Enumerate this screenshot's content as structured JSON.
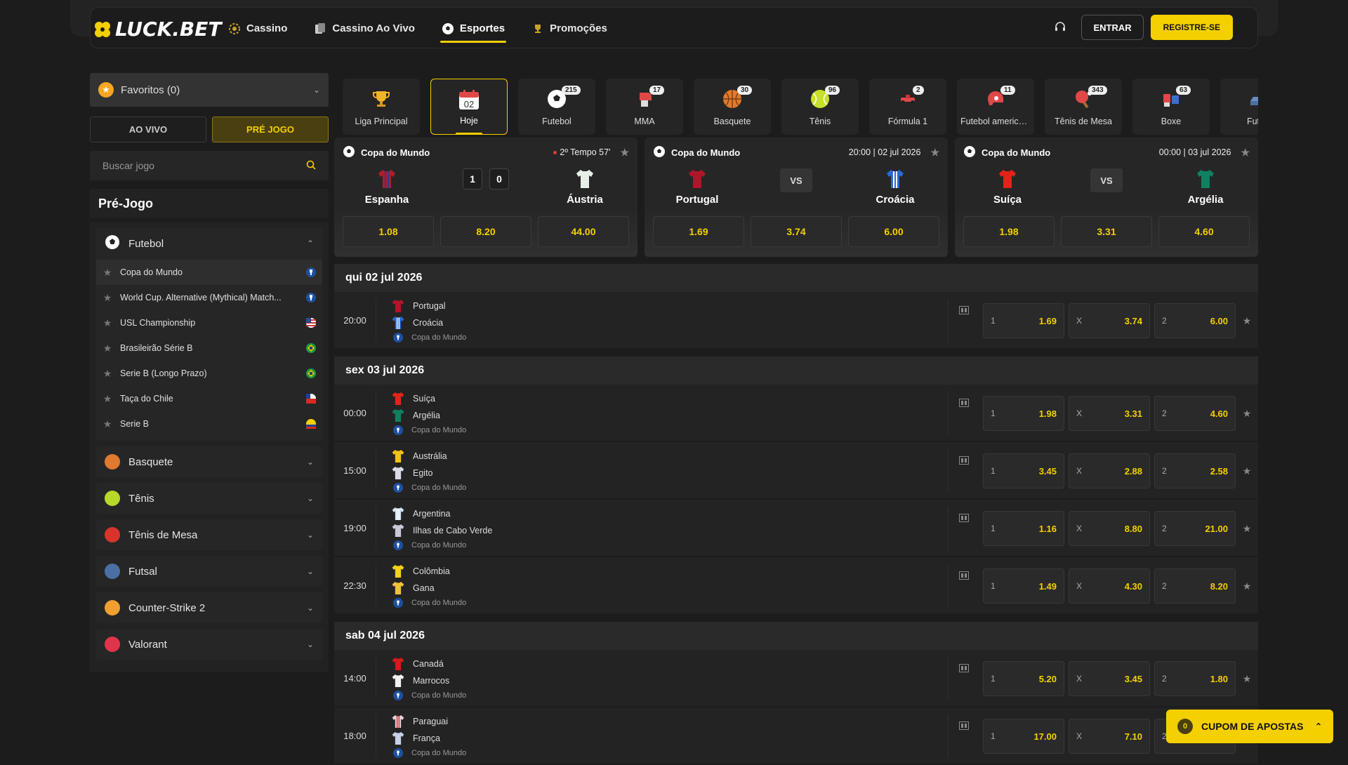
{
  "header": {
    "logo": "LUCK.BET",
    "nav": [
      {
        "label": "Cassino",
        "icon": "casino-chip-icon"
      },
      {
        "label": "Cassino Ao Vivo",
        "icon": "live-cards-icon"
      },
      {
        "label": "Esportes",
        "icon": "soccer-ball-icon"
      },
      {
        "label": "Promoções",
        "icon": "trophy-icon"
      }
    ],
    "login": "ENTRAR",
    "register": "REGISTRE-SE"
  },
  "sidebar": {
    "favorites": "Favoritos (0)",
    "tab_live": "AO VIVO",
    "tab_pre": "PRÉ JOGO",
    "search_placeholder": "Buscar jogo",
    "section_title": "Pré-Jogo",
    "football": "Futebol",
    "leagues": [
      {
        "name": "Copa do Mundo",
        "flag": "world-cup"
      },
      {
        "name": "World Cup. Alternative (Mythical) Match...",
        "flag": "world-cup"
      },
      {
        "name": "USL Championship",
        "flag": "usa"
      },
      {
        "name": "Brasileirão Série B",
        "flag": "brazil"
      },
      {
        "name": "Serie B (Longo Prazo)",
        "flag": "brazil"
      },
      {
        "name": "Taça do Chile",
        "flag": "chile"
      },
      {
        "name": "Serie B",
        "flag": "ecuador"
      }
    ],
    "sports": [
      {
        "name": "Basquete",
        "icon": "basketball-icon",
        "color": "#e07a2e"
      },
      {
        "name": "Tênis",
        "icon": "tennis-ball-icon",
        "color": "#b8d82a"
      },
      {
        "name": "Tênis de Mesa",
        "icon": "ping-pong-icon",
        "color": "#d9342b"
      },
      {
        "name": "Futsal",
        "icon": "futsal-shoe-icon",
        "color": "#4a6fa5"
      },
      {
        "name": "Counter-Strike 2",
        "icon": "cs2-icon",
        "color": "#f0a030"
      },
      {
        "name": "Valorant",
        "icon": "valorant-icon",
        "color": "#e0344a"
      }
    ]
  },
  "categories": [
    {
      "label": "Liga Principal",
      "count": "",
      "icon": "trophy-icon"
    },
    {
      "label": "Hoje",
      "count": "",
      "icon": "calendar-icon",
      "day": "02"
    },
    {
      "label": "Futebol",
      "count": "215",
      "icon": "soccer-ball-icon"
    },
    {
      "label": "MMA",
      "count": "17",
      "icon": "boxing-glove-icon"
    },
    {
      "label": "Basquete",
      "count": "30",
      "icon": "basketball-icon"
    },
    {
      "label": "Tênis",
      "count": "96",
      "icon": "tennis-ball-icon"
    },
    {
      "label": "Fórmula 1",
      "count": "2",
      "icon": "f1-car-icon"
    },
    {
      "label": "Futebol americano",
      "count": "11",
      "icon": "american-football-helmet-icon"
    },
    {
      "label": "Tênis de Mesa",
      "count": "343",
      "icon": "ping-pong-icon"
    },
    {
      "label": "Boxe",
      "count": "63",
      "icon": "boxing-gloves-icon"
    },
    {
      "label": "Futsal",
      "count": "",
      "icon": "futsal-shoe-icon"
    }
  ],
  "featured": [
    {
      "league": "Copa do Mundo",
      "time": "2º Tempo 57'",
      "live": true,
      "home": "Espanha",
      "away": "Áustria",
      "score": [
        "1",
        "0"
      ],
      "odds": [
        "1.08",
        "8.20",
        "44.00"
      ]
    },
    {
      "league": "Copa do Mundo",
      "time": "20:00 | 02 jul 2026",
      "live": false,
      "home": "Portugal",
      "away": "Croácia",
      "vs": "VS",
      "odds": [
        "1.69",
        "3.74",
        "6.00"
      ]
    },
    {
      "league": "Copa do Mundo",
      "time": "00:00 | 03 jul 2026",
      "live": false,
      "home": "Suíça",
      "away": "Argélia",
      "vs": "VS",
      "odds": [
        "1.98",
        "3.31",
        "4.60"
      ]
    }
  ],
  "days": [
    {
      "title": "qui 02 jul 2026",
      "matches": [
        {
          "time": "20:00",
          "home": "Portugal",
          "away": "Croácia",
          "league": "Copa do Mundo",
          "odds": [
            "1.69",
            "3.74",
            "6.00"
          ]
        }
      ]
    },
    {
      "title": "sex 03 jul 2026",
      "matches": [
        {
          "time": "00:00",
          "home": "Suíça",
          "away": "Argélia",
          "league": "Copa do Mundo",
          "odds": [
            "1.98",
            "3.31",
            "4.60"
          ]
        },
        {
          "time": "15:00",
          "home": "Austrália",
          "away": "Egito",
          "league": "Copa do Mundo",
          "odds": [
            "3.45",
            "2.88",
            "2.58"
          ]
        },
        {
          "time": "19:00",
          "home": "Argentina",
          "away": "Ilhas de Cabo Verde",
          "league": "Copa do Mundo",
          "odds": [
            "1.16",
            "8.80",
            "21.00"
          ]
        },
        {
          "time": "22:30",
          "home": "Colômbia",
          "away": "Gana",
          "league": "Copa do Mundo",
          "odds": [
            "1.49",
            "4.30",
            "8.20"
          ]
        }
      ]
    },
    {
      "title": "sab 04 jul 2026",
      "matches": [
        {
          "time": "14:00",
          "home": "Canadá",
          "away": "Marrocos",
          "league": "Copa do Mundo",
          "odds": [
            "5.20",
            "3.45",
            "1.80"
          ]
        },
        {
          "time": "18:00",
          "home": "Paraguai",
          "away": "França",
          "league": "Copa do Mundo",
          "odds": [
            "17.00",
            "7.10",
            ""
          ]
        }
      ]
    }
  ],
  "odd_labels": [
    "1",
    "X",
    "2"
  ],
  "coupon": {
    "count": "0",
    "label": "CUPOM DE APOSTAS"
  },
  "colors": {
    "accent": "#f5d000",
    "background": "#1c1c1c"
  }
}
